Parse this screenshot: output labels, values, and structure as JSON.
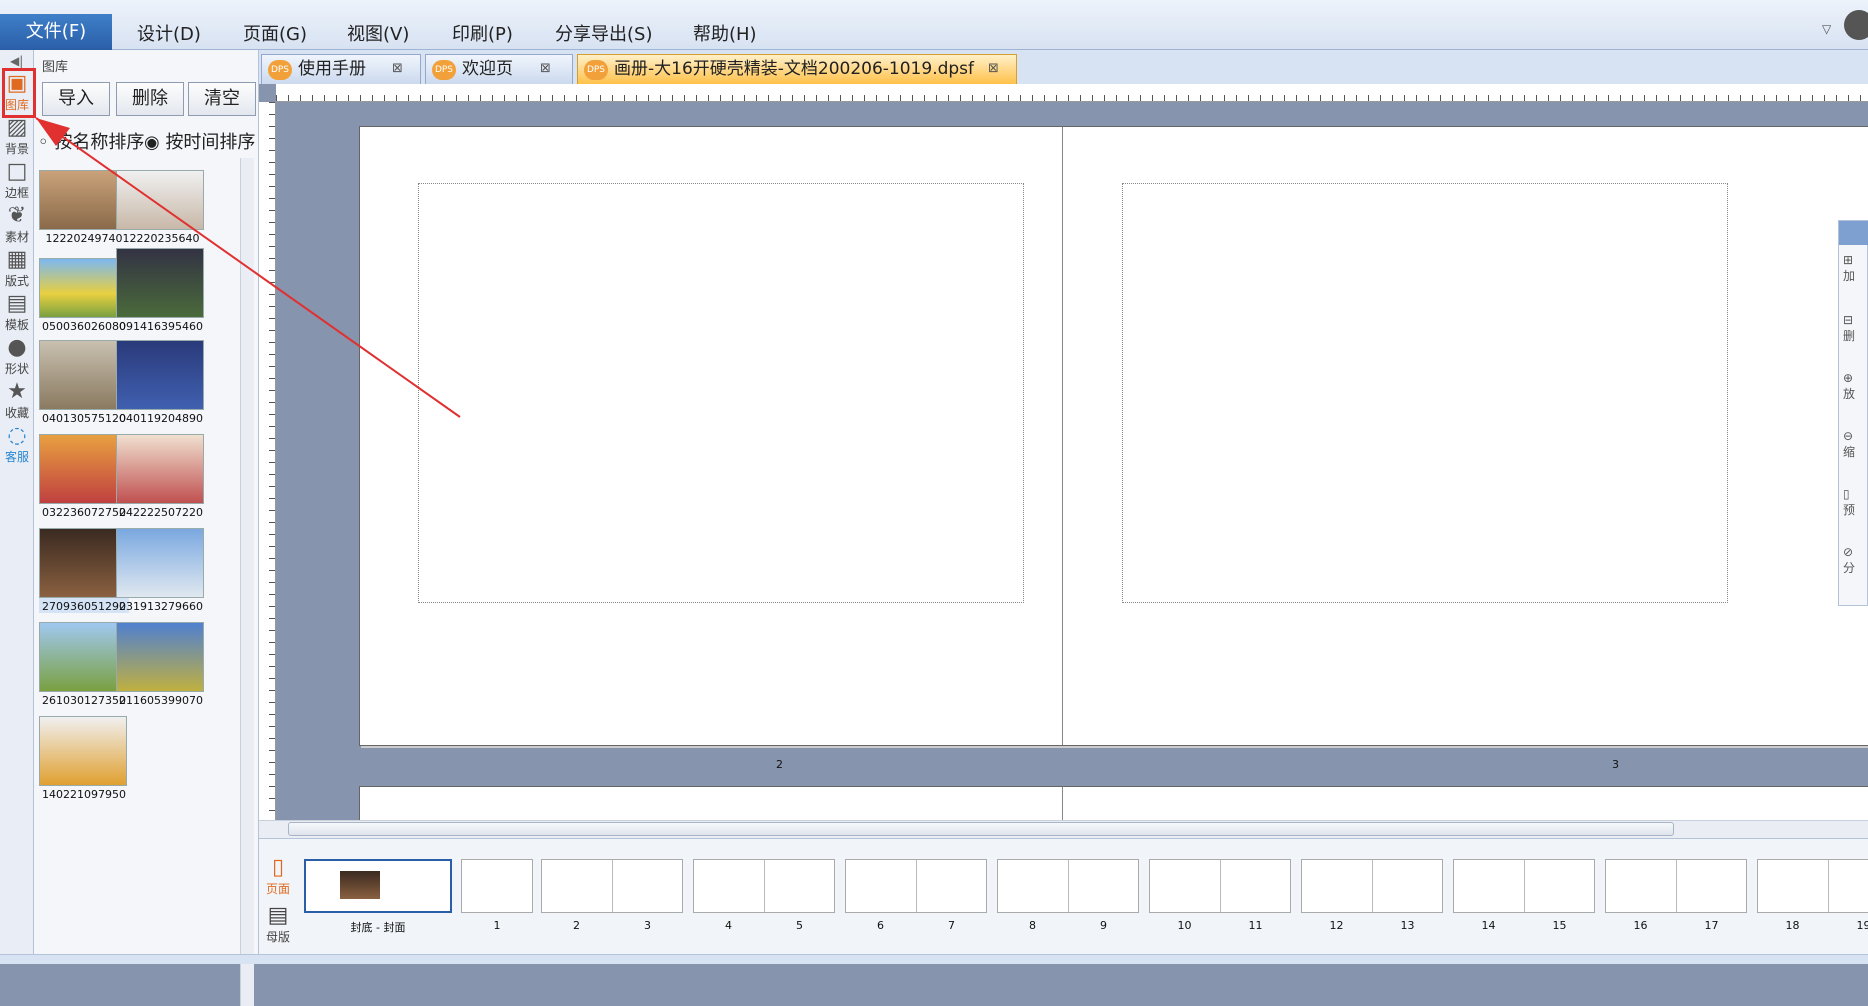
{
  "menu": {
    "file": "文件(F)",
    "design": "设计(D)",
    "page": "页面(G)",
    "view": "视图(V)",
    "print": "印刷(P)",
    "share": "分享导出(S)",
    "help": "帮助(H)"
  },
  "iconbar": [
    {
      "label": "图库",
      "icon": "gallery-icon"
    },
    {
      "label": "背景",
      "icon": "background-icon"
    },
    {
      "label": "边框",
      "icon": "border-icon"
    },
    {
      "label": "素材",
      "icon": "material-icon"
    },
    {
      "label": "版式",
      "icon": "layout-icon"
    },
    {
      "label": "模板",
      "icon": "template-icon"
    },
    {
      "label": "形状",
      "icon": "shape-icon"
    },
    {
      "label": "收藏",
      "icon": "star-icon"
    },
    {
      "label": "客服",
      "icon": "chat-icon"
    }
  ],
  "library": {
    "title": "图库",
    "import": "导入",
    "delete": "删除",
    "clear": "清空",
    "sort_name": "按名称排序",
    "sort_time": "按时间排序",
    "images": [
      "12220249740",
      "12220235640",
      "050036026080",
      "091416395460",
      "040130575120",
      "040119204890",
      "032236072750",
      "242222507220",
      "270936051290",
      "231913279660",
      "261030127350",
      "211605399070",
      "140221097950"
    ]
  },
  "tabs": [
    {
      "label": "使用手册",
      "badge": "DPS"
    },
    {
      "label": "欢迎页",
      "badge": "DPS"
    },
    {
      "label": "画册-大16开硬壳精装-文档200206-1019.dpsf",
      "badge": "DPS"
    }
  ],
  "canvas": {
    "page_left_num": "2",
    "page_right_num": "3"
  },
  "floatbar": [
    "加",
    "删",
    "放",
    "缩",
    "预",
    "分"
  ],
  "strip": {
    "page_tab": "页面",
    "master_tab": "母版",
    "cover_label": "封底 - 封面",
    "numbers": [
      "1",
      "2",
      "3",
      "4",
      "5",
      "6",
      "7",
      "8",
      "9",
      "10",
      "11",
      "12",
      "13",
      "14",
      "15",
      "16",
      "17",
      "18",
      "19"
    ]
  }
}
